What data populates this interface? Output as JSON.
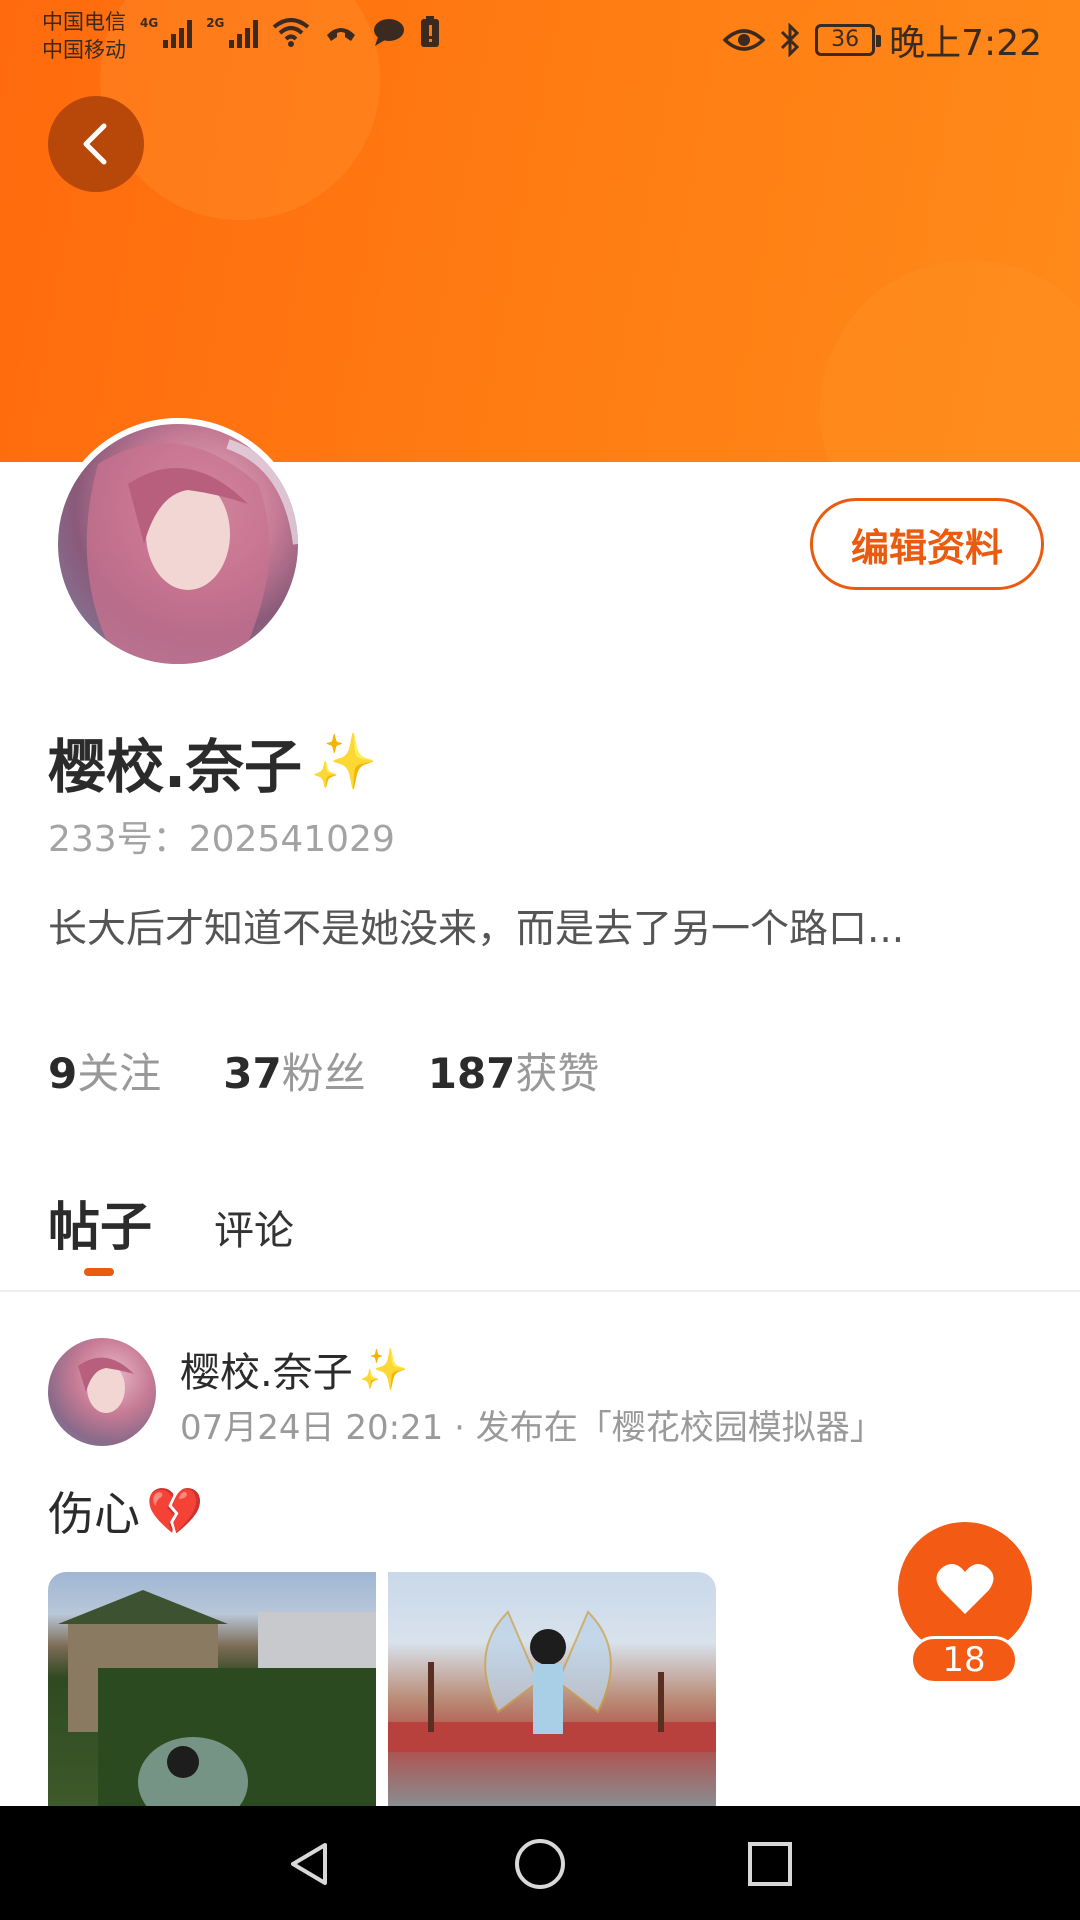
{
  "status_bar": {
    "carrier_1": "中国电信",
    "carrier_2": "中国移动",
    "net_1": "4G",
    "net_2": "2G",
    "battery": "36",
    "time": "晚上7:22",
    "icons": [
      "signal-icon",
      "wifi-icon",
      "call-icon",
      "message-icon",
      "alert-icon",
      "eye-icon",
      "bluetooth-icon",
      "battery-icon"
    ]
  },
  "header": {
    "back_icon": "chevron-left-icon",
    "accent_color": "#ff7a12"
  },
  "profile": {
    "edit_button": "编辑资料",
    "username": "樱校.奈子",
    "username_emoji": "✨",
    "user_id": "233号：202541029",
    "bio": "长大后才知道不是她没来，而是去了另一个路口..."
  },
  "stats": [
    {
      "number": "9",
      "label": "关注"
    },
    {
      "number": "37",
      "label": "粉丝"
    },
    {
      "number": "187",
      "label": "获赞"
    }
  ],
  "tabs": {
    "posts": "帖子",
    "comments": "评论"
  },
  "post": {
    "author": "樱校.奈子",
    "author_emoji": "✨",
    "meta": "07月24日 20:21 · 发布在「樱花校园模拟器」",
    "text": "伤心",
    "text_emoji": "💔",
    "like_count": "18"
  }
}
